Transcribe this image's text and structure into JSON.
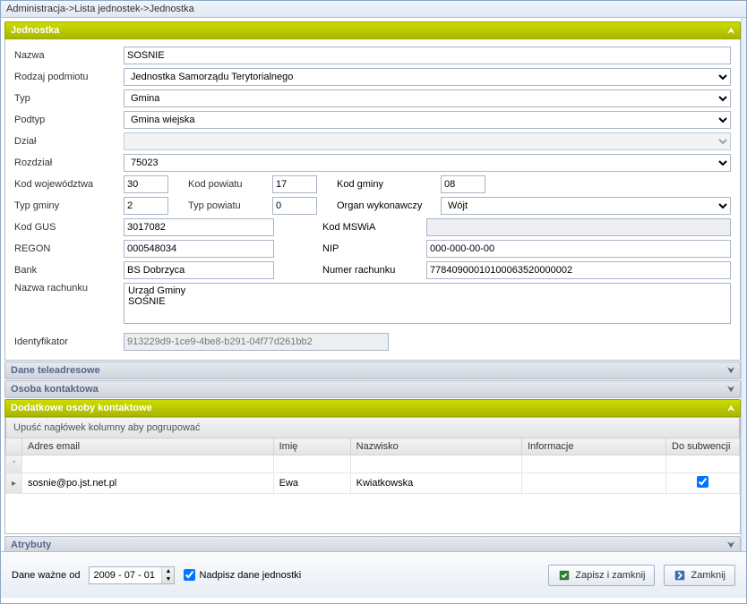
{
  "breadcrumb": "Administracja->Lista jednostek->Jednostka",
  "sections": {
    "jednostka": "Jednostka",
    "contact": "Dane teleadresowe",
    "person": "Osoba kontaktowa",
    "extra": "Dodatkowe osoby kontaktowe",
    "attrs": "Atrybuty"
  },
  "labels": {
    "nazwa": "Nazwa",
    "rodzaj": "Rodzaj podmiotu",
    "typ": "Typ",
    "podtyp": "Podtyp",
    "dzial": "Dział",
    "rozdzial": "Rozdział",
    "kodwoj": "Kod województwa",
    "kodpow": "Kod powiatu",
    "kodgm": "Kod gminy",
    "typgm": "Typ gminy",
    "typpow": "Typ powiatu",
    "organ": "Organ wykonawczy",
    "kodgus": "Kod GUS",
    "kodmsw": "Kod MSWiA",
    "regon": "REGON",
    "nip": "NIP",
    "bank": "Bank",
    "numrach": "Numer rachunku",
    "nazwarach": "Nazwa rachunku",
    "ident": "Identyfikator"
  },
  "values": {
    "nazwa": "SOŚNIE",
    "rodzaj": "Jednostka Samorządu Terytorialnego",
    "typ": "Gmina",
    "podtyp": "Gmina wiejska",
    "dzial": "",
    "rozdzial": "75023",
    "kodwoj": "30",
    "kodpow": "17",
    "kodgm": "08",
    "typgm": "2",
    "typpow": "0",
    "organ": "Wójt",
    "kodgus": "3017082",
    "kodmsw": "",
    "regon": "000548034",
    "nip": "000-000-00-00",
    "bank": "BS Dobrzyca",
    "numrach": "77840900010100063520000002",
    "nazwarach": "Urząd Gminy\nSOŚNIE",
    "ident": "913229d9-1ce9-4be8-b291-04f77d261bb2"
  },
  "grid": {
    "groupby_hint": "Upuść nagłówek kolumny aby pogrupować",
    "cols": {
      "email": "Adres email",
      "imie": "Imię",
      "nazwisko": "Nazwisko",
      "info": "Informacje",
      "subw": "Do subwencji"
    },
    "row": {
      "email": "sosnie@po.jst.net.pl",
      "imie": "Ewa",
      "nazwisko": "Kwiatkowska",
      "info": "",
      "subw": true
    }
  },
  "bottom": {
    "valid_from": "Dane ważne od",
    "date": "2009 - 07 - 01",
    "overwrite": "Nadpisz dane jednostki",
    "save": "Zapisz i zamknij",
    "close": "Zamknij"
  }
}
